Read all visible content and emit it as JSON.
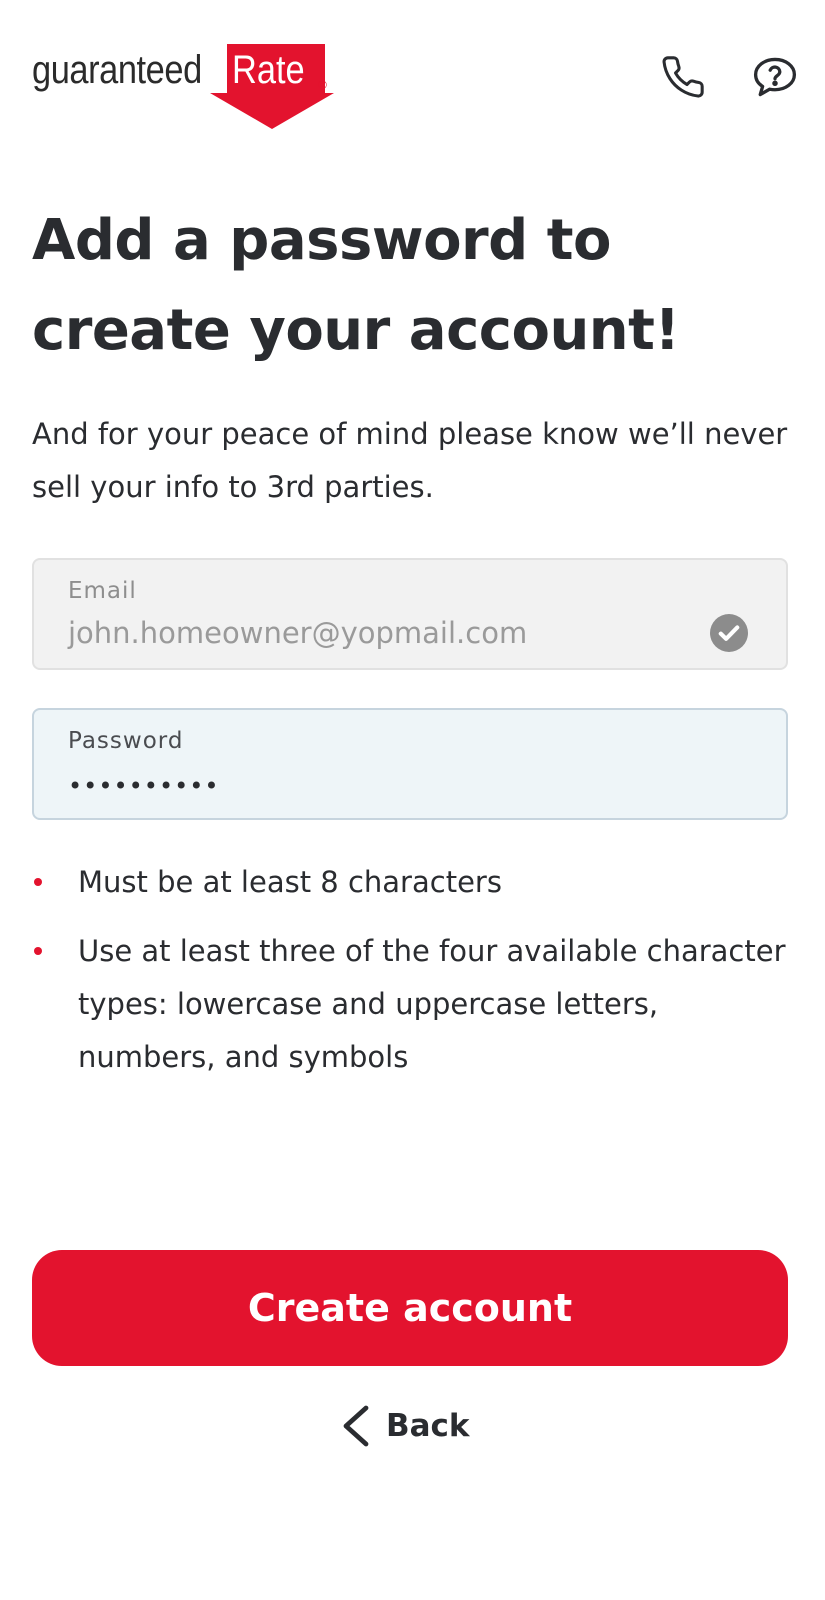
{
  "header": {
    "logo": {
      "word_1": "guaranteed",
      "word_2": "Rate",
      "registered_mark": "®"
    },
    "phone_icon": "phone-icon",
    "help_icon": "help-chat-icon"
  },
  "main": {
    "title": "Add a password to create your account!",
    "subtitle": "And for your peace of mind please know we’ll never sell your info to 3rd parties."
  },
  "form": {
    "email": {
      "label": "Email",
      "value": "john.homeowner@yopmail.com",
      "status_icon": "check-circle-icon"
    },
    "password": {
      "label": "Password",
      "value": "••••••••••"
    }
  },
  "requirements": [
    "Must be at least 8 characters",
    "Use at least three of the four available character types: lowercase and uppercase letters, numbers, and symbols"
  ],
  "actions": {
    "create_label": "Create account",
    "back_label": "Back"
  },
  "colors": {
    "brand_red": "#e3132e",
    "text": "#2a2c30",
    "email_field_bg": "#f2f2f2",
    "password_field_bg": "#eef5f8"
  }
}
